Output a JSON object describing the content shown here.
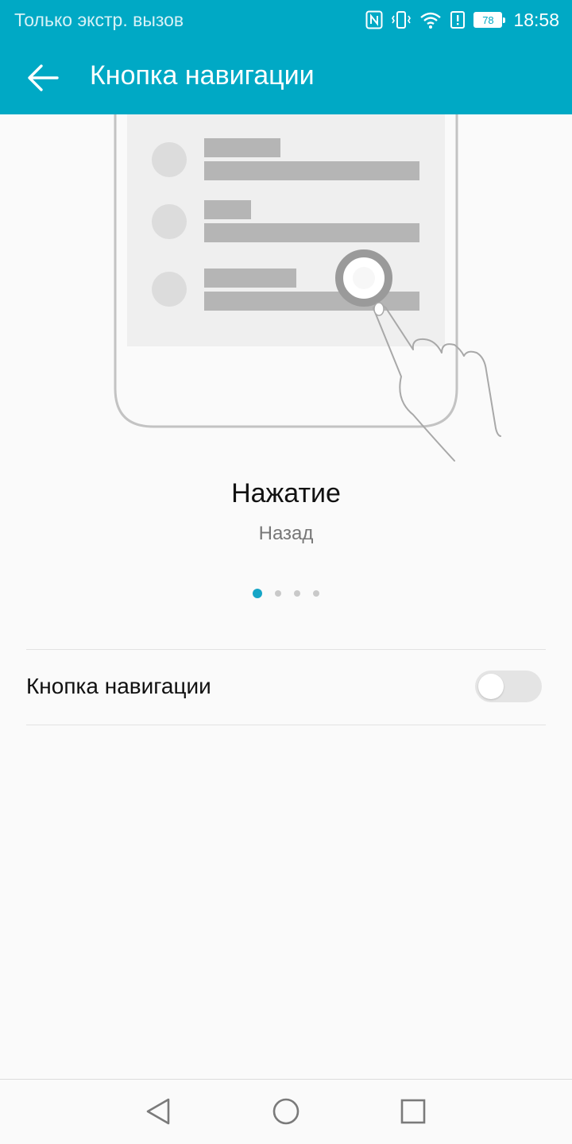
{
  "status_bar": {
    "carrier_text": "Только экстр. вызов",
    "battery_level": "78",
    "time": "18:58",
    "icons": [
      "nfc-icon",
      "vibrate-icon",
      "wifi-icon",
      "alert-icon",
      "battery-icon"
    ]
  },
  "app_bar": {
    "title": "Кнопка навигации",
    "back_icon": "arrow-left-icon"
  },
  "gesture": {
    "title": "Нажатие",
    "subtitle": "Назад"
  },
  "pager": {
    "total": 4,
    "active_index": 0
  },
  "setting": {
    "label": "Кнопка навигации",
    "enabled": false
  },
  "nav_bar": {
    "buttons": [
      "back-triangle-icon",
      "home-circle-icon",
      "recents-square-icon"
    ]
  },
  "colors": {
    "accent": "#00a9c5",
    "background": "#fafafa",
    "pager_active": "#16a5c6",
    "pager_inactive": "#c9c9c9"
  }
}
